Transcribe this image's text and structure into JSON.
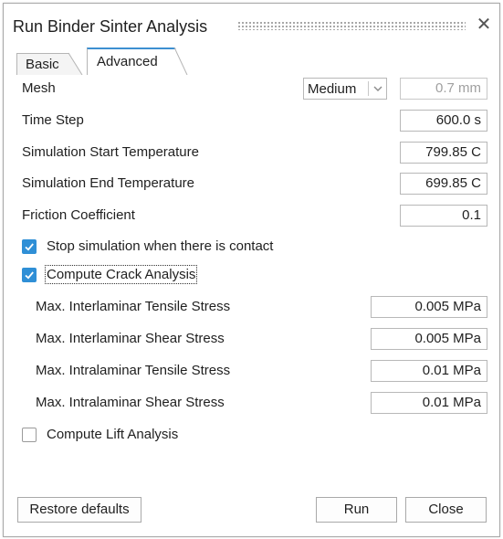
{
  "window": {
    "title": "Run Binder Sinter Analysis",
    "close_glyph": "✕"
  },
  "tabs": [
    {
      "label": "Basic",
      "active": false
    },
    {
      "label": "Advanced",
      "active": true
    }
  ],
  "mesh": {
    "label": "Mesh",
    "preset": "Medium",
    "value": "0.7 mm"
  },
  "time_step": {
    "label": "Time Step",
    "value": "600.0 s"
  },
  "start_temp": {
    "label": "Simulation Start Temperature",
    "value": "799.85 C"
  },
  "end_temp": {
    "label": "Simulation End Temperature",
    "value": "699.85 C"
  },
  "friction": {
    "label": "Friction Coefficient",
    "value": "0.1"
  },
  "stop_on_contact": {
    "label": "Stop simulation when there is contact",
    "checked": true
  },
  "crack": {
    "label": "Compute Crack Analysis",
    "checked": true,
    "fields": [
      {
        "label": "Max. Interlaminar Tensile Stress",
        "value": "0.005 MPa"
      },
      {
        "label": "Max. Interlaminar Shear Stress",
        "value": "0.005 MPa"
      },
      {
        "label": "Max. Intralaminar Tensile Stress",
        "value": "0.01 MPa"
      },
      {
        "label": "Max. Intralaminar Shear Stress",
        "value": "0.01 MPa"
      }
    ]
  },
  "lift": {
    "label": "Compute Lift Analysis",
    "checked": false
  },
  "buttons": {
    "restore": "Restore defaults",
    "run": "Run",
    "close": "Close"
  },
  "colors": {
    "accent": "#2f8fd6",
    "border": "#b8b8b8"
  }
}
